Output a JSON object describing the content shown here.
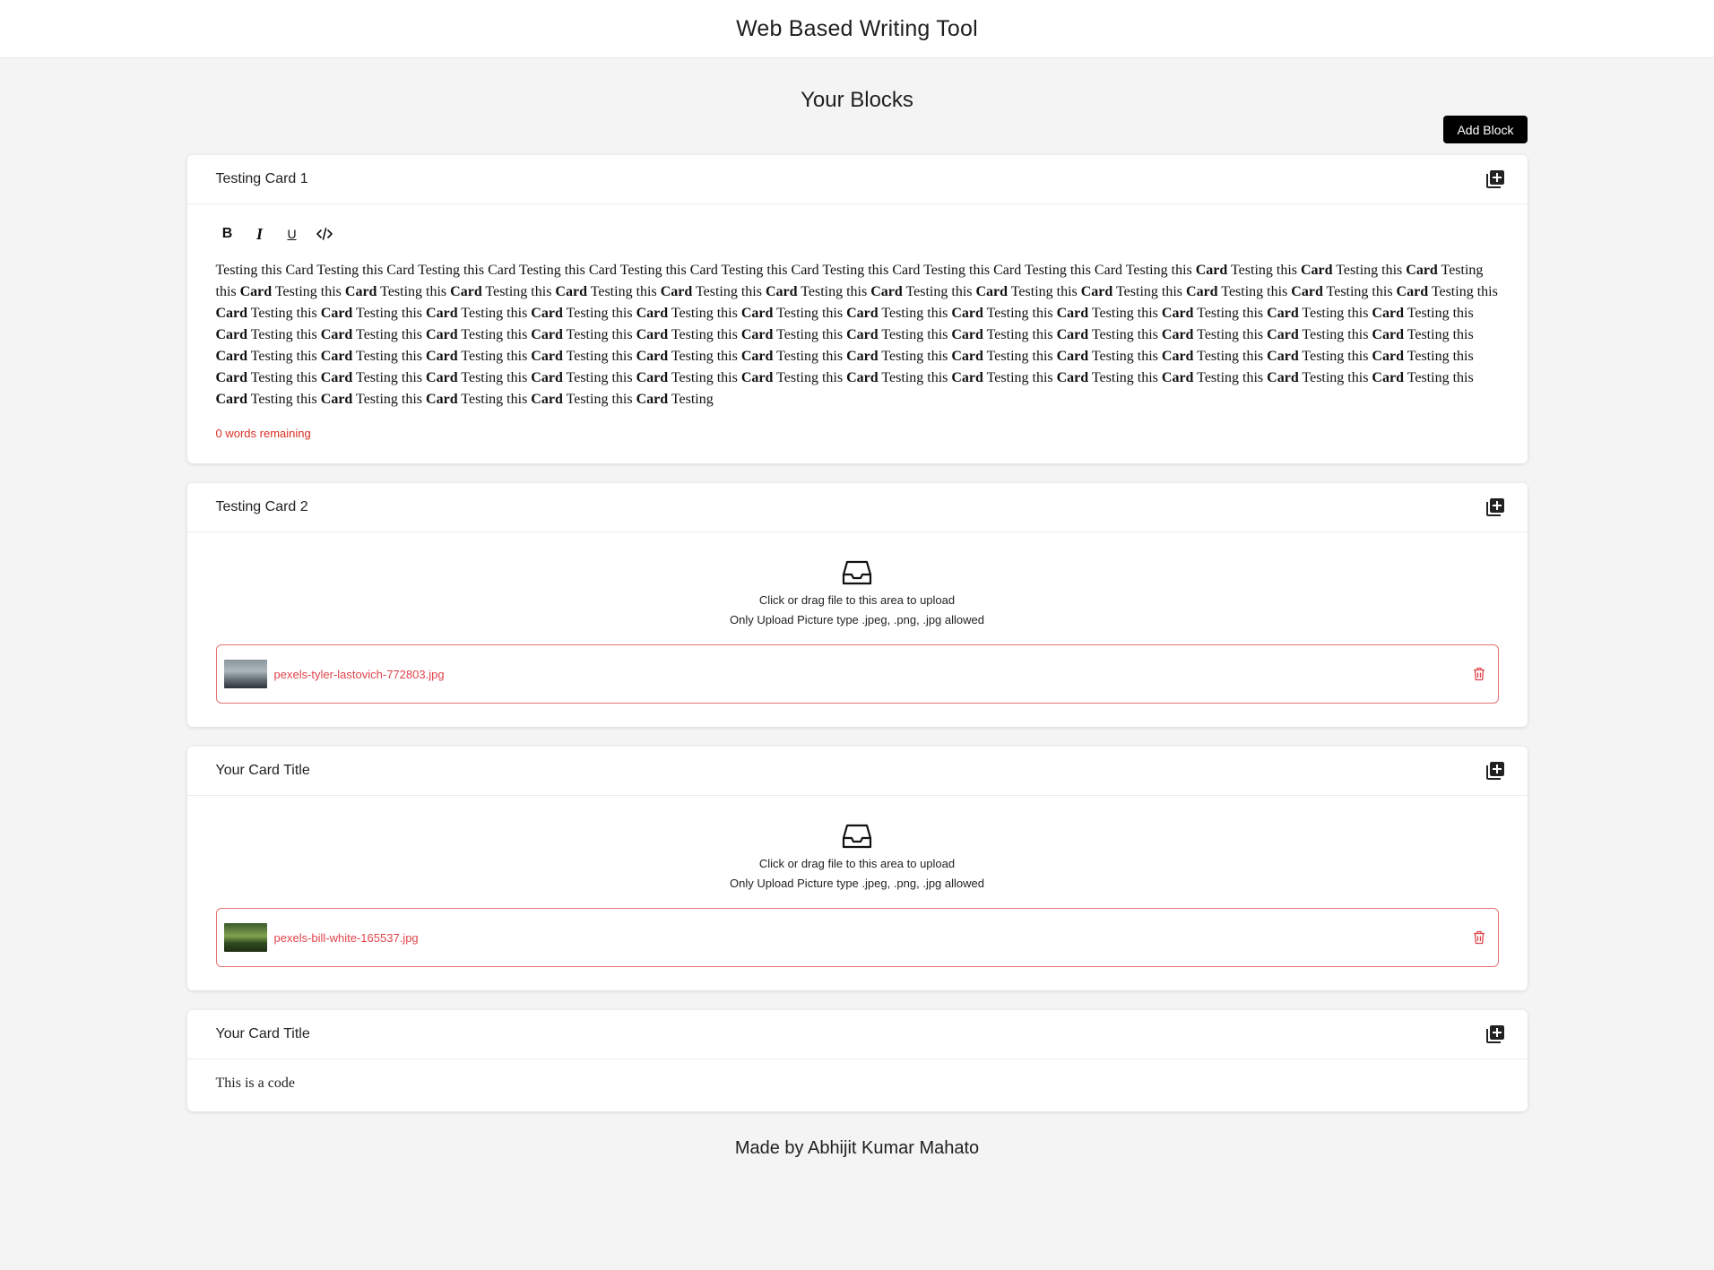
{
  "app": {
    "title": "Web Based Writing Tool"
  },
  "page": {
    "heading": "Your Blocks",
    "add_block_label": "Add Block"
  },
  "cards": [
    {
      "title": "Testing Card 1",
      "type": "text",
      "toolbar": [
        "bold-icon",
        "italic-icon",
        "underline-icon",
        "code-icon"
      ],
      "text_segments": [
        {
          "t": "Testing this Card Testing this Card Testing this Card Testing this Card Testing this Card Testing this Card Testing this Card Testing this Card Testing this Card Testing this ",
          "b": false
        },
        {
          "t": "Card",
          "b": true
        },
        {
          "t": " Testing this ",
          "b": false
        },
        {
          "t": "Card",
          "b": true
        },
        {
          "t": " Testing this ",
          "b": false
        },
        {
          "t": "Card",
          "b": true
        },
        {
          "t": " Testing this ",
          "b": false
        },
        {
          "t": "Card",
          "b": true
        },
        {
          "t": " Testing this ",
          "b": false
        },
        {
          "t": "Card",
          "b": true
        },
        {
          "t": " Testing this ",
          "b": false
        },
        {
          "t": "Card",
          "b": true
        },
        {
          "t": " Testing this ",
          "b": false
        },
        {
          "t": "Card",
          "b": true
        },
        {
          "t": " Testing this ",
          "b": false
        },
        {
          "t": "Card",
          "b": true
        },
        {
          "t": " Testing this ",
          "b": false
        },
        {
          "t": "Card",
          "b": true
        },
        {
          "t": " Testing this ",
          "b": false
        },
        {
          "t": "Card",
          "b": true
        },
        {
          "t": " Testing this ",
          "b": false
        },
        {
          "t": "Card",
          "b": true
        },
        {
          "t": " Testing this ",
          "b": false
        },
        {
          "t": "Card",
          "b": true
        },
        {
          "t": " Testing this ",
          "b": false
        },
        {
          "t": "Card",
          "b": true
        },
        {
          "t": " Testing this ",
          "b": false
        },
        {
          "t": "Card",
          "b": true
        },
        {
          "t": " Testing this ",
          "b": false
        },
        {
          "t": "Card",
          "b": true
        },
        {
          "t": " Testing this ",
          "b": false
        },
        {
          "t": "Card",
          "b": true
        },
        {
          "t": " Testing this ",
          "b": false
        },
        {
          "t": "Card",
          "b": true
        },
        {
          "t": " Testing this ",
          "b": false
        },
        {
          "t": "Card",
          "b": true
        },
        {
          "t": " Testing this ",
          "b": false
        },
        {
          "t": "Card",
          "b": true
        },
        {
          "t": " Testing this ",
          "b": false
        },
        {
          "t": "Card",
          "b": true
        },
        {
          "t": " Testing this ",
          "b": false
        },
        {
          "t": "Card",
          "b": true
        },
        {
          "t": " Testing this ",
          "b": false
        },
        {
          "t": "Card",
          "b": true
        },
        {
          "t": " Testing this ",
          "b": false
        },
        {
          "t": "Card",
          "b": true
        },
        {
          "t": " Testing this ",
          "b": false
        },
        {
          "t": "Card",
          "b": true
        },
        {
          "t": " Testing this ",
          "b": false
        },
        {
          "t": "Card",
          "b": true
        },
        {
          "t": " Testing this ",
          "b": false
        },
        {
          "t": "Card",
          "b": true
        },
        {
          "t": " Testing this ",
          "b": false
        },
        {
          "t": "Card",
          "b": true
        },
        {
          "t": " Testing this ",
          "b": false
        },
        {
          "t": "Card",
          "b": true
        },
        {
          "t": " Testing this ",
          "b": false
        },
        {
          "t": "Card",
          "b": true
        },
        {
          "t": " Testing this ",
          "b": false
        },
        {
          "t": "Card",
          "b": true
        },
        {
          "t": " Testing this ",
          "b": false
        },
        {
          "t": "Card",
          "b": true
        },
        {
          "t": " Testing this ",
          "b": false
        },
        {
          "t": "Card",
          "b": true
        },
        {
          "t": " Testing this ",
          "b": false
        },
        {
          "t": "Card",
          "b": true
        },
        {
          "t": " Testing this ",
          "b": false
        },
        {
          "t": "Card",
          "b": true
        },
        {
          "t": " Testing this ",
          "b": false
        },
        {
          "t": "Card",
          "b": true
        },
        {
          "t": " Testing this ",
          "b": false
        },
        {
          "t": "Card",
          "b": true
        },
        {
          "t": " Testing this ",
          "b": false
        },
        {
          "t": "Card",
          "b": true
        },
        {
          "t": " Testing this ",
          "b": false
        },
        {
          "t": "Card",
          "b": true
        },
        {
          "t": " Testing this ",
          "b": false
        },
        {
          "t": "Card",
          "b": true
        },
        {
          "t": " Testing this ",
          "b": false
        },
        {
          "t": "Card",
          "b": true
        },
        {
          "t": " Testing this ",
          "b": false
        },
        {
          "t": "Card",
          "b": true
        },
        {
          "t": " Testing this ",
          "b": false
        },
        {
          "t": "Card",
          "b": true
        },
        {
          "t": " Testing this ",
          "b": false
        },
        {
          "t": "Card",
          "b": true
        },
        {
          "t": " Testing this ",
          "b": false
        },
        {
          "t": "Card",
          "b": true
        },
        {
          "t": " Testing this ",
          "b": false
        },
        {
          "t": "Card",
          "b": true
        },
        {
          "t": " Testing this ",
          "b": false
        },
        {
          "t": "Card",
          "b": true
        },
        {
          "t": " Testing this ",
          "b": false
        },
        {
          "t": "Card",
          "b": true
        },
        {
          "t": " Testing this ",
          "b": false
        },
        {
          "t": "Card",
          "b": true
        },
        {
          "t": " Testing this ",
          "b": false
        },
        {
          "t": "Card",
          "b": true
        },
        {
          "t": " Testing this ",
          "b": false
        },
        {
          "t": "Card",
          "b": true
        },
        {
          "t": " Testing this ",
          "b": false
        },
        {
          "t": "Card",
          "b": true
        },
        {
          "t": " Testing this ",
          "b": false
        },
        {
          "t": "Card",
          "b": true
        },
        {
          "t": " Testing this ",
          "b": false
        },
        {
          "t": "Card",
          "b": true
        },
        {
          "t": " Testing this ",
          "b": false
        },
        {
          "t": "Card",
          "b": true
        },
        {
          "t": " Testing this ",
          "b": false
        },
        {
          "t": "Card",
          "b": true
        },
        {
          "t": " Testing this ",
          "b": false
        },
        {
          "t": "Card",
          "b": true
        },
        {
          "t": " Testing this ",
          "b": false
        },
        {
          "t": "Card",
          "b": true
        },
        {
          "t": " Testing this ",
          "b": false
        },
        {
          "t": "Card",
          "b": true
        },
        {
          "t": " Testing this ",
          "b": false
        },
        {
          "t": "Card",
          "b": true
        },
        {
          "t": " Testing this ",
          "b": false
        },
        {
          "t": "Card",
          "b": true
        },
        {
          "t": " Testing this ",
          "b": false
        },
        {
          "t": "Card",
          "b": true
        },
        {
          "t": " Testing this ",
          "b": false
        },
        {
          "t": "Card",
          "b": true
        },
        {
          "t": " Testing this ",
          "b": false
        },
        {
          "t": "Card",
          "b": true
        },
        {
          "t": " Testing this ",
          "b": false
        },
        {
          "t": "Card",
          "b": true
        },
        {
          "t": " Testing this ",
          "b": false
        },
        {
          "t": "Card",
          "b": true
        },
        {
          "t": " Testing this ",
          "b": false
        },
        {
          "t": "Card",
          "b": true
        },
        {
          "t": " Testing this ",
          "b": false
        },
        {
          "t": "Card",
          "b": true
        },
        {
          "t": " Testing this ",
          "b": false
        },
        {
          "t": "Card",
          "b": true
        },
        {
          "t": " Testing",
          "b": false
        }
      ],
      "words_remaining": "0 words remaining"
    },
    {
      "title": "Testing Card 2",
      "type": "upload",
      "upload_line1": "Click or drag file to this area to upload",
      "upload_line2": "Only Upload Picture type .jpeg, .png, .jpg allowed",
      "file_name": "pexels-tyler-lastovich-772803.jpg",
      "thumb": "mist"
    },
    {
      "title": "Your Card Title",
      "type": "upload",
      "upload_line1": "Click or drag file to this area to upload",
      "upload_line2": "Only Upload Picture type .jpeg, .png, .jpg allowed",
      "file_name": "pexels-bill-white-165537.jpg",
      "thumb": "forest"
    },
    {
      "title": "Your Card Title",
      "type": "code",
      "text": "This is a code"
    }
  ],
  "footer": {
    "text": "Made by Abhijit Kumar Mahato"
  },
  "colors": {
    "accent_red": "#e0444b",
    "button_black": "#000000",
    "background": "#f4f4f4"
  }
}
